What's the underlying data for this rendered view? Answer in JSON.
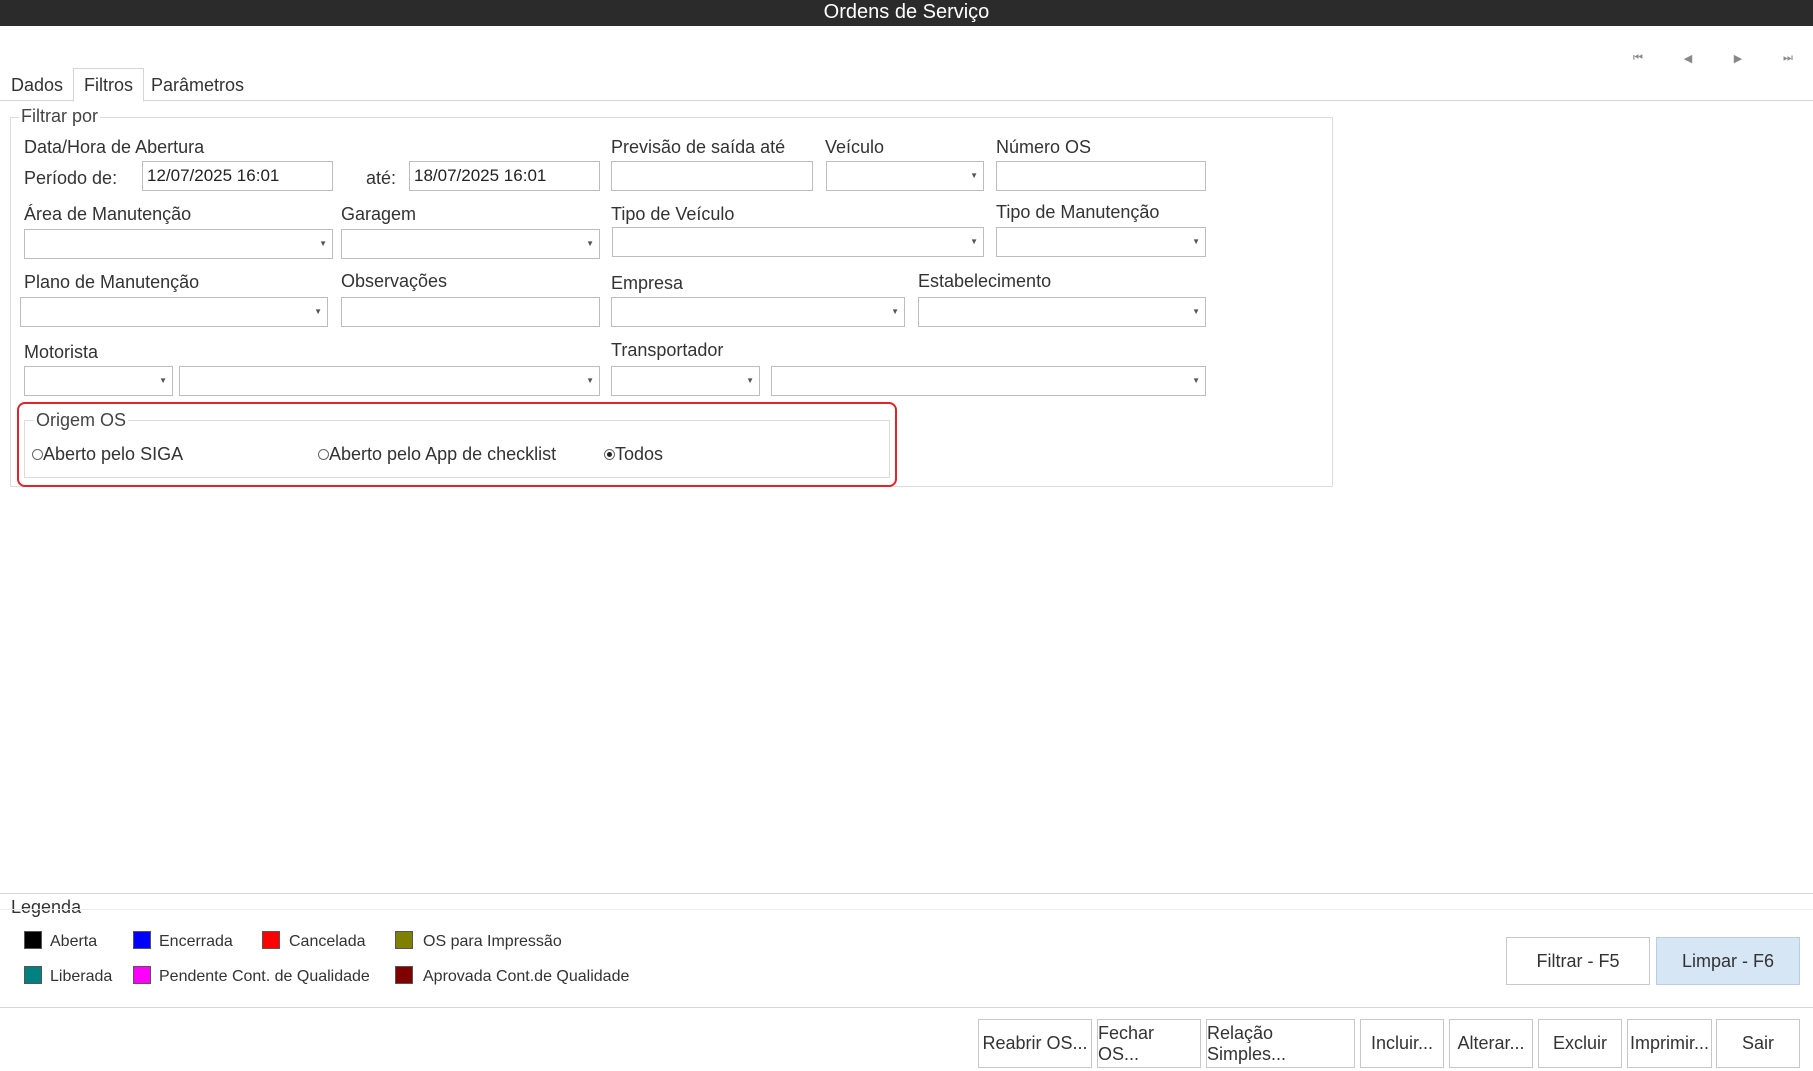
{
  "window": {
    "title": "Ordens de Serviço"
  },
  "nav": {
    "first_icon": "first-page-icon",
    "prev_icon": "previous-icon",
    "next_icon": "next-icon",
    "last_icon": "last-page-icon"
  },
  "tabs": [
    {
      "label": "Dados",
      "active": false
    },
    {
      "label": "Filtros",
      "active": true
    },
    {
      "label": "Parâmetros",
      "active": false
    }
  ],
  "filter": {
    "group_title": "Filtrar por",
    "data_hora_label": "Data/Hora de Abertura",
    "periodo_label": "Período de:",
    "periodo_de": "12/07/2025 16:01",
    "ate_label": "até:",
    "periodo_ate": "18/07/2025 16:01",
    "previsao_label": "Previsão de saída até",
    "previsao_value": "",
    "veiculo_label": "Veículo",
    "veiculo_value": "",
    "numero_os_label": "Número OS",
    "numero_os_value": "",
    "area_label": "Área de Manutenção",
    "garagem_label": "Garagem",
    "tipo_veiculo_label": "Tipo de Veículo",
    "tipo_manutencao_label": "Tipo de Manutenção",
    "plano_label": "Plano de Manutenção",
    "observacoes_label": "Observações",
    "observacoes_value": "",
    "empresa_label": "Empresa",
    "estabelecimento_label": "Estabelecimento",
    "motorista_label": "Motorista",
    "transportador_label": "Transportador"
  },
  "origem": {
    "title": "Origem OS",
    "options": [
      {
        "label": "Aberto pelo SIGA",
        "checked": false
      },
      {
        "label": "Aberto pelo App de checklist",
        "checked": false
      },
      {
        "label": "Todos",
        "checked": true
      }
    ]
  },
  "legenda": {
    "title": "Legenda",
    "items": [
      {
        "label": "Aberta",
        "color": "#000000"
      },
      {
        "label": "Encerrada",
        "color": "#0000ff"
      },
      {
        "label": "Cancelada",
        "color": "#ff0000"
      },
      {
        "label": "OS para Impressão",
        "color": "#808000"
      },
      {
        "label": "Liberada",
        "color": "#008080"
      },
      {
        "label": "Pendente Cont. de Qualidade",
        "color": "#ff00ff"
      },
      {
        "label": "Aprovada Cont.de Qualidade",
        "color": "#800000"
      }
    ]
  },
  "filter_buttons": {
    "filtrar": "Filtrar - F5",
    "limpar": "Limpar - F6"
  },
  "actions": {
    "reabrir": "Reabrir OS...",
    "fechar": "Fechar OS...",
    "relacao": "Relação Simples...",
    "incluir": "Incluir...",
    "alterar": "Alterar...",
    "excluir": "Excluir",
    "imprimir": "Imprimir...",
    "sair": "Sair"
  }
}
